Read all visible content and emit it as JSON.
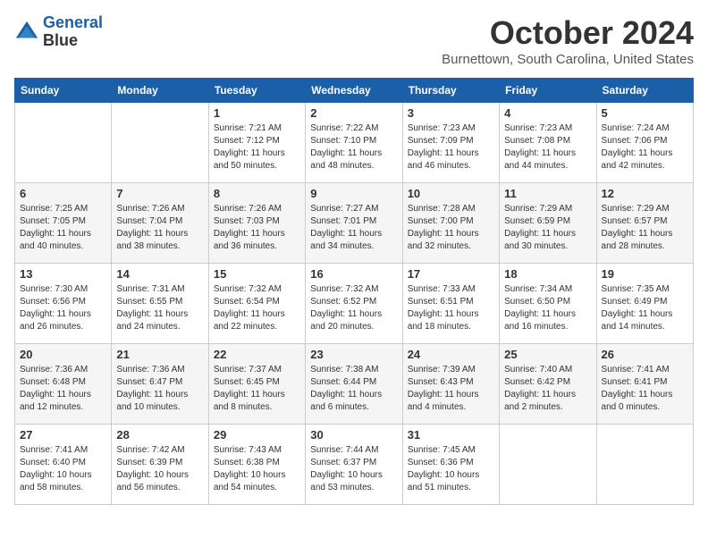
{
  "logo": {
    "line1": "General",
    "line2": "Blue"
  },
  "header": {
    "month": "October 2024",
    "location": "Burnettown, South Carolina, United States"
  },
  "weekdays": [
    "Sunday",
    "Monday",
    "Tuesday",
    "Wednesday",
    "Thursday",
    "Friday",
    "Saturday"
  ],
  "weeks": [
    [
      {
        "day": null,
        "info": null
      },
      {
        "day": null,
        "info": null
      },
      {
        "day": "1",
        "info": "Sunrise: 7:21 AM\nSunset: 7:12 PM\nDaylight: 11 hours and 50 minutes."
      },
      {
        "day": "2",
        "info": "Sunrise: 7:22 AM\nSunset: 7:10 PM\nDaylight: 11 hours and 48 minutes."
      },
      {
        "day": "3",
        "info": "Sunrise: 7:23 AM\nSunset: 7:09 PM\nDaylight: 11 hours and 46 minutes."
      },
      {
        "day": "4",
        "info": "Sunrise: 7:23 AM\nSunset: 7:08 PM\nDaylight: 11 hours and 44 minutes."
      },
      {
        "day": "5",
        "info": "Sunrise: 7:24 AM\nSunset: 7:06 PM\nDaylight: 11 hours and 42 minutes."
      }
    ],
    [
      {
        "day": "6",
        "info": "Sunrise: 7:25 AM\nSunset: 7:05 PM\nDaylight: 11 hours and 40 minutes."
      },
      {
        "day": "7",
        "info": "Sunrise: 7:26 AM\nSunset: 7:04 PM\nDaylight: 11 hours and 38 minutes."
      },
      {
        "day": "8",
        "info": "Sunrise: 7:26 AM\nSunset: 7:03 PM\nDaylight: 11 hours and 36 minutes."
      },
      {
        "day": "9",
        "info": "Sunrise: 7:27 AM\nSunset: 7:01 PM\nDaylight: 11 hours and 34 minutes."
      },
      {
        "day": "10",
        "info": "Sunrise: 7:28 AM\nSunset: 7:00 PM\nDaylight: 11 hours and 32 minutes."
      },
      {
        "day": "11",
        "info": "Sunrise: 7:29 AM\nSunset: 6:59 PM\nDaylight: 11 hours and 30 minutes."
      },
      {
        "day": "12",
        "info": "Sunrise: 7:29 AM\nSunset: 6:57 PM\nDaylight: 11 hours and 28 minutes."
      }
    ],
    [
      {
        "day": "13",
        "info": "Sunrise: 7:30 AM\nSunset: 6:56 PM\nDaylight: 11 hours and 26 minutes."
      },
      {
        "day": "14",
        "info": "Sunrise: 7:31 AM\nSunset: 6:55 PM\nDaylight: 11 hours and 24 minutes."
      },
      {
        "day": "15",
        "info": "Sunrise: 7:32 AM\nSunset: 6:54 PM\nDaylight: 11 hours and 22 minutes."
      },
      {
        "day": "16",
        "info": "Sunrise: 7:32 AM\nSunset: 6:52 PM\nDaylight: 11 hours and 20 minutes."
      },
      {
        "day": "17",
        "info": "Sunrise: 7:33 AM\nSunset: 6:51 PM\nDaylight: 11 hours and 18 minutes."
      },
      {
        "day": "18",
        "info": "Sunrise: 7:34 AM\nSunset: 6:50 PM\nDaylight: 11 hours and 16 minutes."
      },
      {
        "day": "19",
        "info": "Sunrise: 7:35 AM\nSunset: 6:49 PM\nDaylight: 11 hours and 14 minutes."
      }
    ],
    [
      {
        "day": "20",
        "info": "Sunrise: 7:36 AM\nSunset: 6:48 PM\nDaylight: 11 hours and 12 minutes."
      },
      {
        "day": "21",
        "info": "Sunrise: 7:36 AM\nSunset: 6:47 PM\nDaylight: 11 hours and 10 minutes."
      },
      {
        "day": "22",
        "info": "Sunrise: 7:37 AM\nSunset: 6:45 PM\nDaylight: 11 hours and 8 minutes."
      },
      {
        "day": "23",
        "info": "Sunrise: 7:38 AM\nSunset: 6:44 PM\nDaylight: 11 hours and 6 minutes."
      },
      {
        "day": "24",
        "info": "Sunrise: 7:39 AM\nSunset: 6:43 PM\nDaylight: 11 hours and 4 minutes."
      },
      {
        "day": "25",
        "info": "Sunrise: 7:40 AM\nSunset: 6:42 PM\nDaylight: 11 hours and 2 minutes."
      },
      {
        "day": "26",
        "info": "Sunrise: 7:41 AM\nSunset: 6:41 PM\nDaylight: 11 hours and 0 minutes."
      }
    ],
    [
      {
        "day": "27",
        "info": "Sunrise: 7:41 AM\nSunset: 6:40 PM\nDaylight: 10 hours and 58 minutes."
      },
      {
        "day": "28",
        "info": "Sunrise: 7:42 AM\nSunset: 6:39 PM\nDaylight: 10 hours and 56 minutes."
      },
      {
        "day": "29",
        "info": "Sunrise: 7:43 AM\nSunset: 6:38 PM\nDaylight: 10 hours and 54 minutes."
      },
      {
        "day": "30",
        "info": "Sunrise: 7:44 AM\nSunset: 6:37 PM\nDaylight: 10 hours and 53 minutes."
      },
      {
        "day": "31",
        "info": "Sunrise: 7:45 AM\nSunset: 6:36 PM\nDaylight: 10 hours and 51 minutes."
      },
      {
        "day": null,
        "info": null
      },
      {
        "day": null,
        "info": null
      }
    ]
  ]
}
